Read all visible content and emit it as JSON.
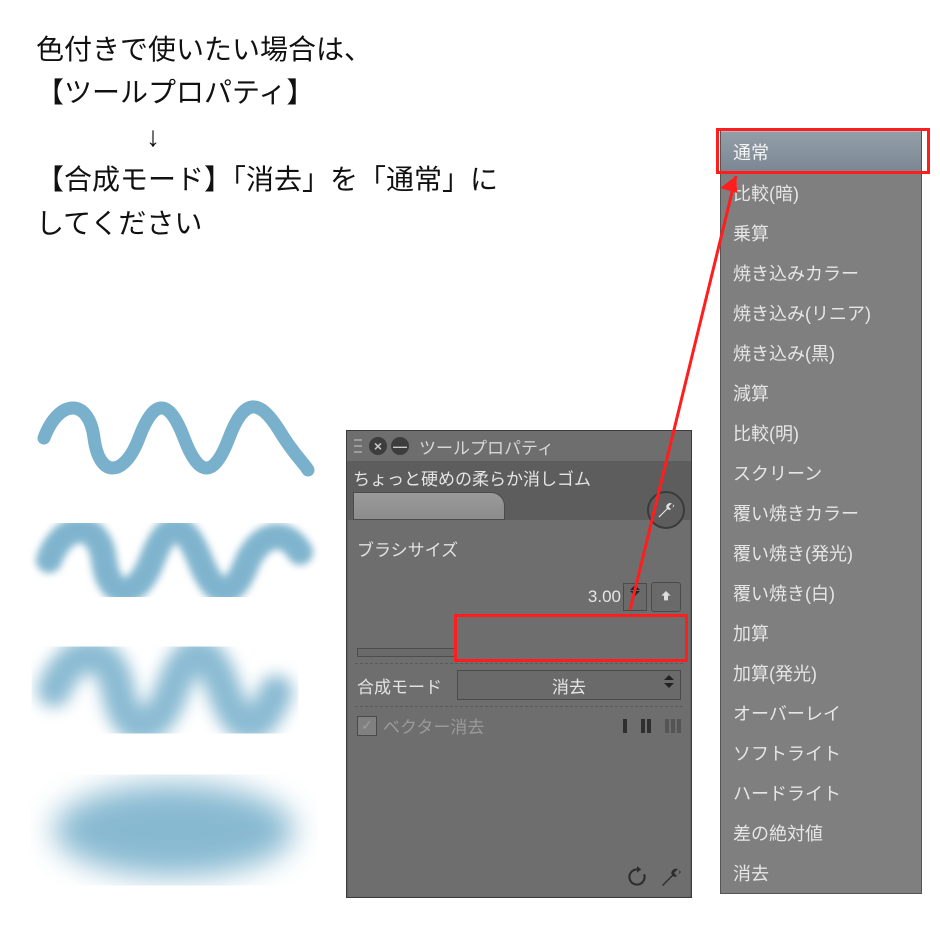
{
  "instruction": {
    "line1": "色付きで使いたい場合は、",
    "line2": "【ツールプロパティ】",
    "arrow": "↓",
    "line3": "【合成モード】「消去」を「通常」に",
    "line4": "してください"
  },
  "panel": {
    "title": "ツールプロパティ",
    "sub_tool_name": "ちょっと硬めの柔らか消しゴム",
    "brush_size_label": "ブラシサイズ",
    "brush_size_value": "3.00",
    "blend_mode_label": "合成モード",
    "blend_mode_value": "消去",
    "vector_erase_label": "ベクター消去"
  },
  "blend_modes": [
    "通常",
    "比較(暗)",
    "乗算",
    "焼き込みカラー",
    "焼き込み(リニア)",
    "焼き込み(黒)",
    "減算",
    "比較(明)",
    "スクリーン",
    "覆い焼きカラー",
    "覆い焼き(発光)",
    "覆い焼き(白)",
    "加算",
    "加算(発光)",
    "オーバーレイ",
    "ソフトライト",
    "ハードライト",
    "差の絶対値",
    "消去"
  ],
  "icons": {
    "close": "×",
    "minimize": "—"
  }
}
